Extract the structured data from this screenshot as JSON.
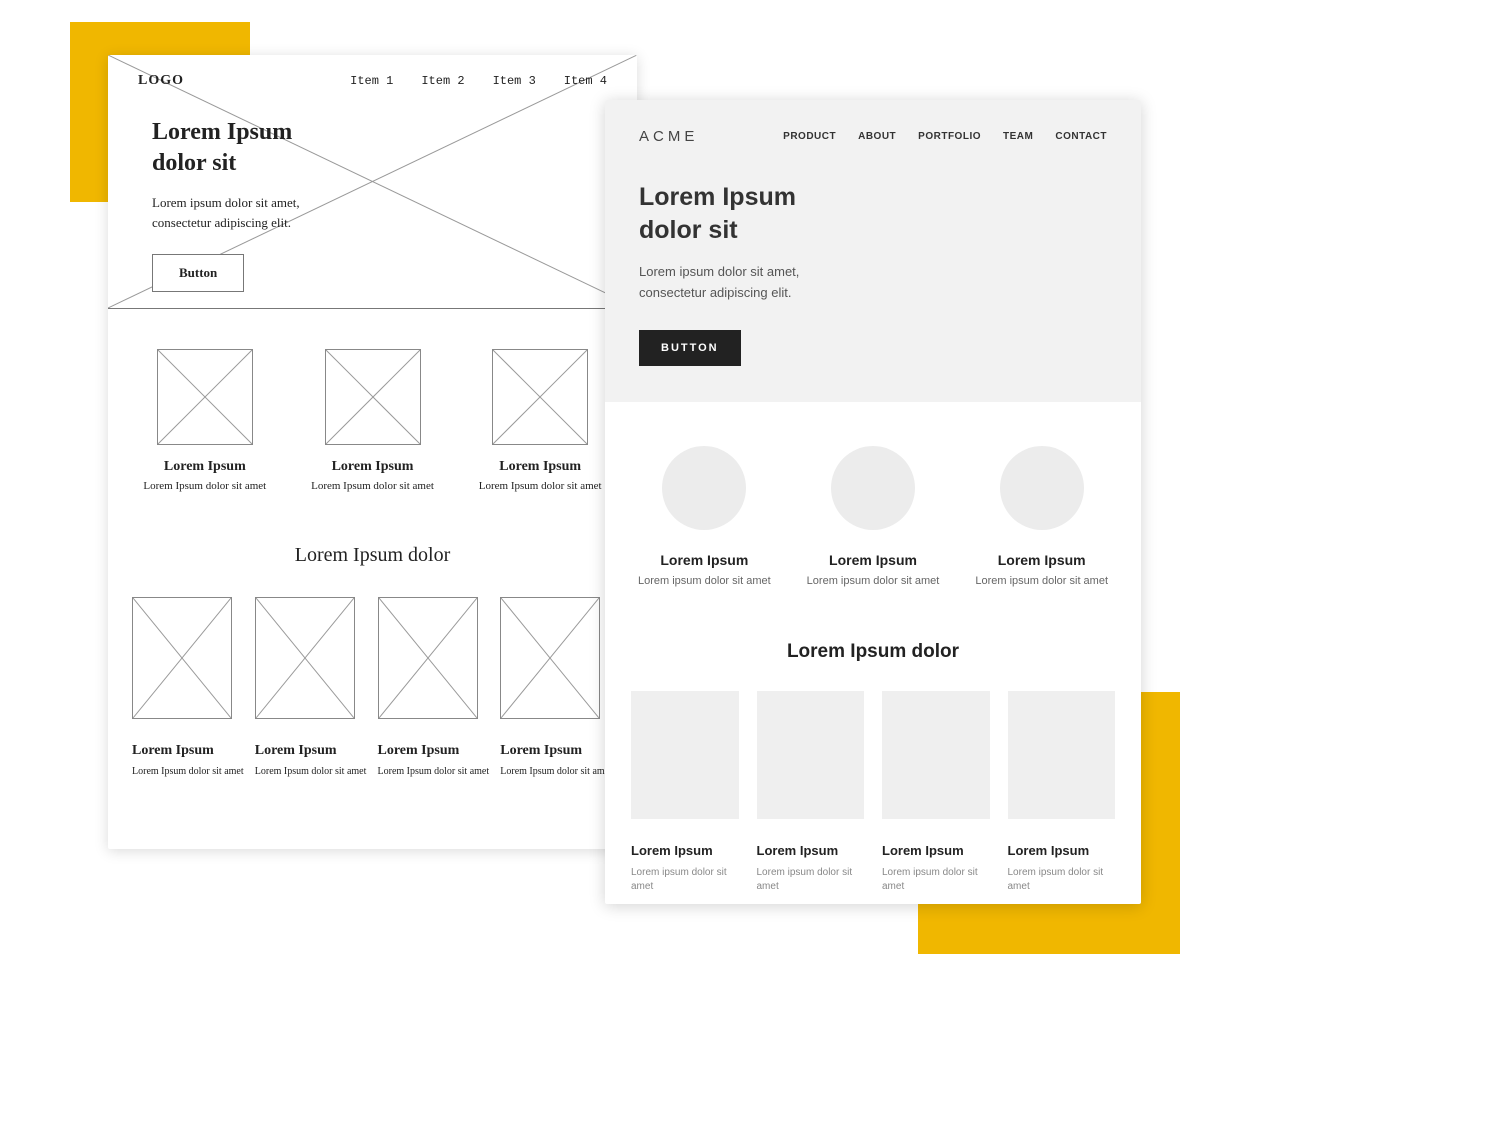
{
  "accents": {
    "color": "#f0b700"
  },
  "wire": {
    "logo": "LOGO",
    "nav": [
      "Item 1",
      "Item 2",
      "Item 3",
      "Item 4"
    ],
    "hero": {
      "title_l1": "Lorem Ipsum",
      "title_l2": "dolor sit",
      "body_l1": "Lorem ipsum dolor sit amet,",
      "body_l2": "consectetur adipiscing elit.",
      "button": "Button"
    },
    "features": [
      {
        "title": "Lorem Ipsum",
        "sub": "Lorem Ipsum dolor sit amet"
      },
      {
        "title": "Lorem Ipsum",
        "sub": "Lorem Ipsum dolor sit amet"
      },
      {
        "title": "Lorem Ipsum",
        "sub": "Lorem Ipsum dolor sit amet"
      }
    ],
    "section_title": "Lorem Ipsum dolor",
    "gallery": [
      {
        "title": "Lorem Ipsum",
        "sub": "Lorem Ipsum dolor sit amet"
      },
      {
        "title": "Lorem Ipsum",
        "sub": "Lorem Ipsum dolor sit amet"
      },
      {
        "title": "Lorem Ipsum",
        "sub": "Lorem Ipsum dolor sit amet"
      },
      {
        "title": "Lorem Ipsum",
        "sub": "Lorem Ipsum dolor sit amet"
      }
    ]
  },
  "hifi": {
    "logo": "ACME",
    "nav": [
      "PRODUCT",
      "ABOUT",
      "PORTFOLIO",
      "TEAM",
      "CONTACT"
    ],
    "hero": {
      "title_l1": "Lorem Ipsum",
      "title_l2": "dolor sit",
      "body_l1": "Lorem ipsum dolor sit amet,",
      "body_l2": "consectetur adipiscing elit.",
      "button": "BUTTON"
    },
    "features": [
      {
        "title": "Lorem Ipsum",
        "sub": "Lorem ipsum dolor sit amet"
      },
      {
        "title": "Lorem Ipsum",
        "sub": "Lorem ipsum dolor sit amet"
      },
      {
        "title": "Lorem Ipsum",
        "sub": "Lorem ipsum dolor sit amet"
      }
    ],
    "section_title": "Lorem Ipsum dolor",
    "gallery": [
      {
        "title": "Lorem Ipsum",
        "sub": "Lorem ipsum dolor sit amet"
      },
      {
        "title": "Lorem Ipsum",
        "sub": "Lorem ipsum dolor sit amet"
      },
      {
        "title": "Lorem Ipsum",
        "sub": "Lorem ipsum dolor sit amet"
      },
      {
        "title": "Lorem Ipsum",
        "sub": "Lorem ipsum dolor sit amet"
      }
    ]
  }
}
